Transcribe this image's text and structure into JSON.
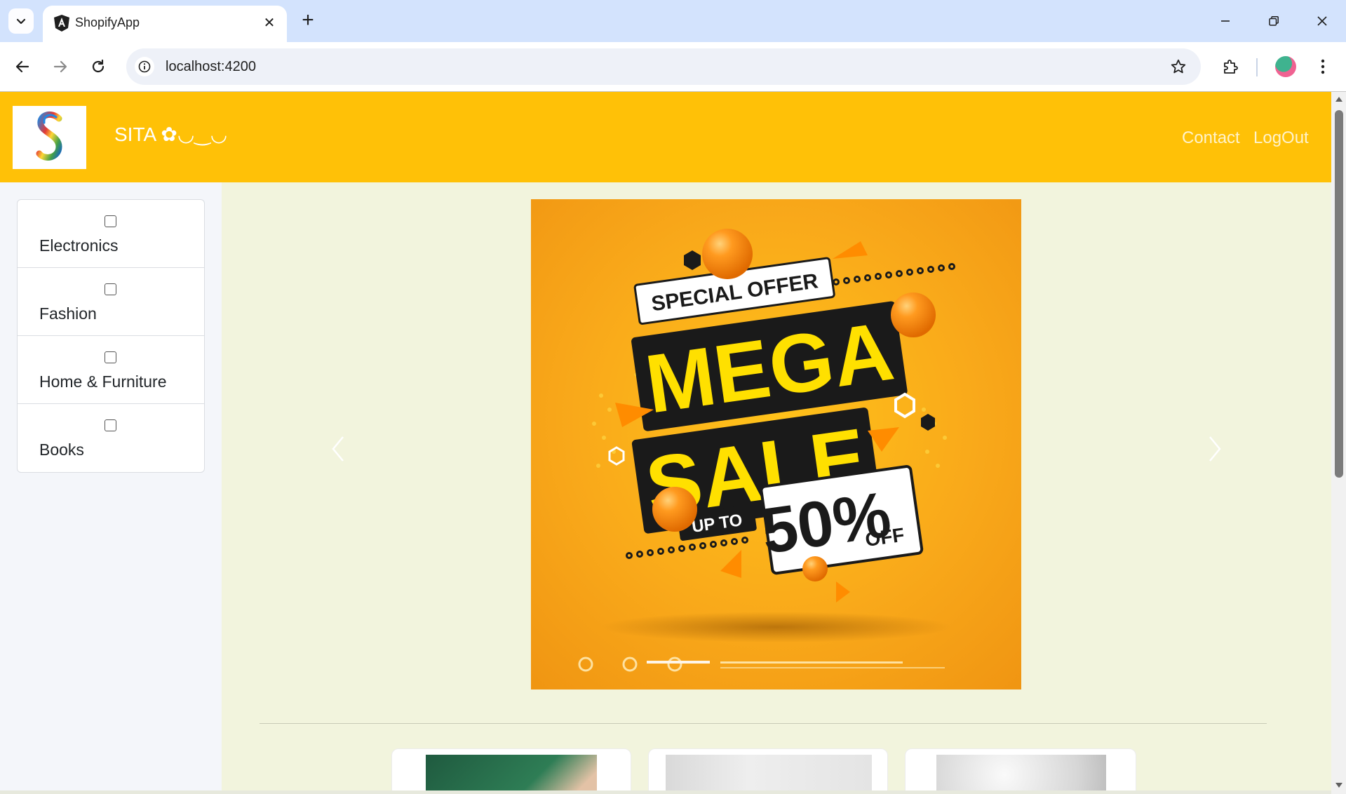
{
  "browser": {
    "tab_title": "ShopifyApp",
    "url": "localhost:4200"
  },
  "header": {
    "brand": "SITA ✿◡‿◡",
    "nav": {
      "contact": "Contact",
      "logout": "LogOut"
    }
  },
  "sidebar": {
    "categories": [
      {
        "label": "Electronics",
        "checked": false
      },
      {
        "label": "Fashion",
        "checked": false
      },
      {
        "label": "Home & Furniture",
        "checked": false
      },
      {
        "label": "Books",
        "checked": false
      }
    ]
  },
  "carousel": {
    "banner": {
      "tag": "SPECIAL OFFER",
      "headline_1": "MEGA",
      "headline_2": "SALE",
      "up_to": "UP TO",
      "percent": "50%",
      "off": "OFF"
    }
  },
  "colors": {
    "header_bg": "#ffc107",
    "page_bg": "#f2f4dd",
    "sidebar_bg": "#f4f6fa"
  }
}
